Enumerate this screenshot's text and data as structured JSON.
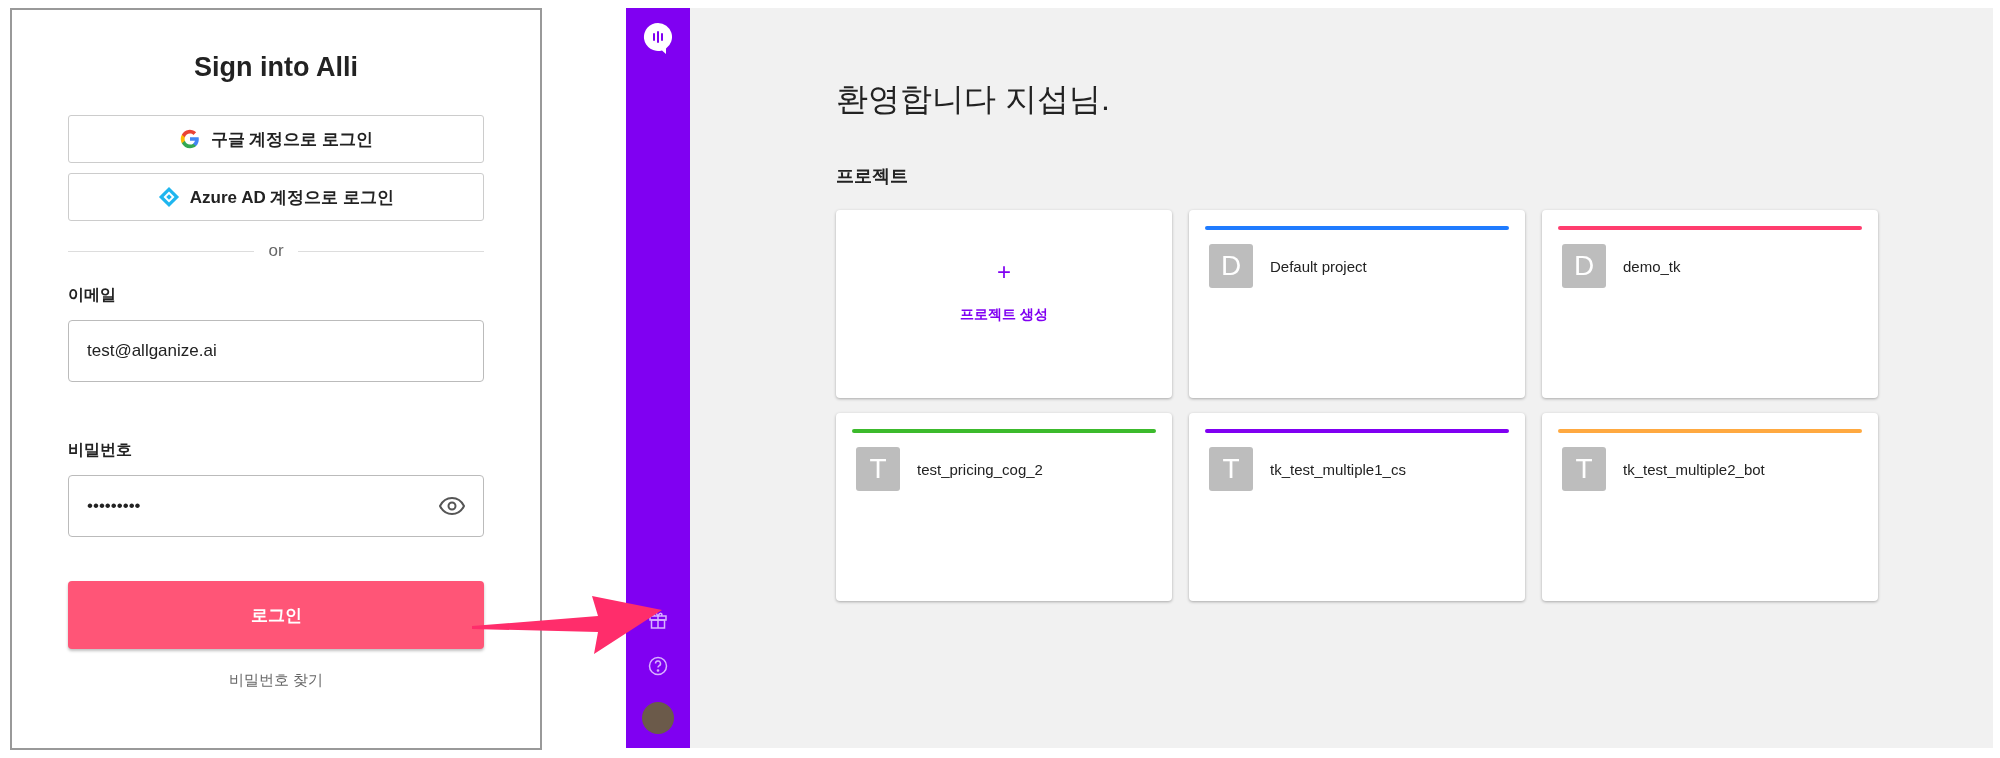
{
  "login": {
    "title": "Sign into Alli",
    "sso_buttons": [
      {
        "kind": "google",
        "label": "구글 계정으로 로그인"
      },
      {
        "kind": "azure",
        "label": "Azure AD 계정으로 로그인"
      }
    ],
    "divider": "or",
    "email": {
      "label": "이메일",
      "value": "test@allganize.ai"
    },
    "password": {
      "label": "비밀번호",
      "value": "•••••••••"
    },
    "submit": "로그인",
    "forgot": "비밀번호 찾기"
  },
  "main": {
    "greeting": "환영합니다 지섭님.",
    "section_title": "프로젝트",
    "cards": [
      {
        "kind": "create",
        "icon": "+",
        "label": "프로젝트 생성"
      },
      {
        "kind": "project",
        "initial": "D",
        "name": "Default project",
        "color": "#1f7bff"
      },
      {
        "kind": "project",
        "initial": "D",
        "name": "demo_tk",
        "color": "#ff3d6e"
      },
      {
        "kind": "project",
        "initial": "T",
        "name": "test_pricing_cog_2",
        "color": "#3cba2c"
      },
      {
        "kind": "project",
        "initial": "T",
        "name": "tk_test_multiple1_cs",
        "color": "#8000f2"
      },
      {
        "kind": "project",
        "initial": "T",
        "name": "tk_test_multiple2_bot",
        "color": "#ffa940"
      }
    ]
  }
}
